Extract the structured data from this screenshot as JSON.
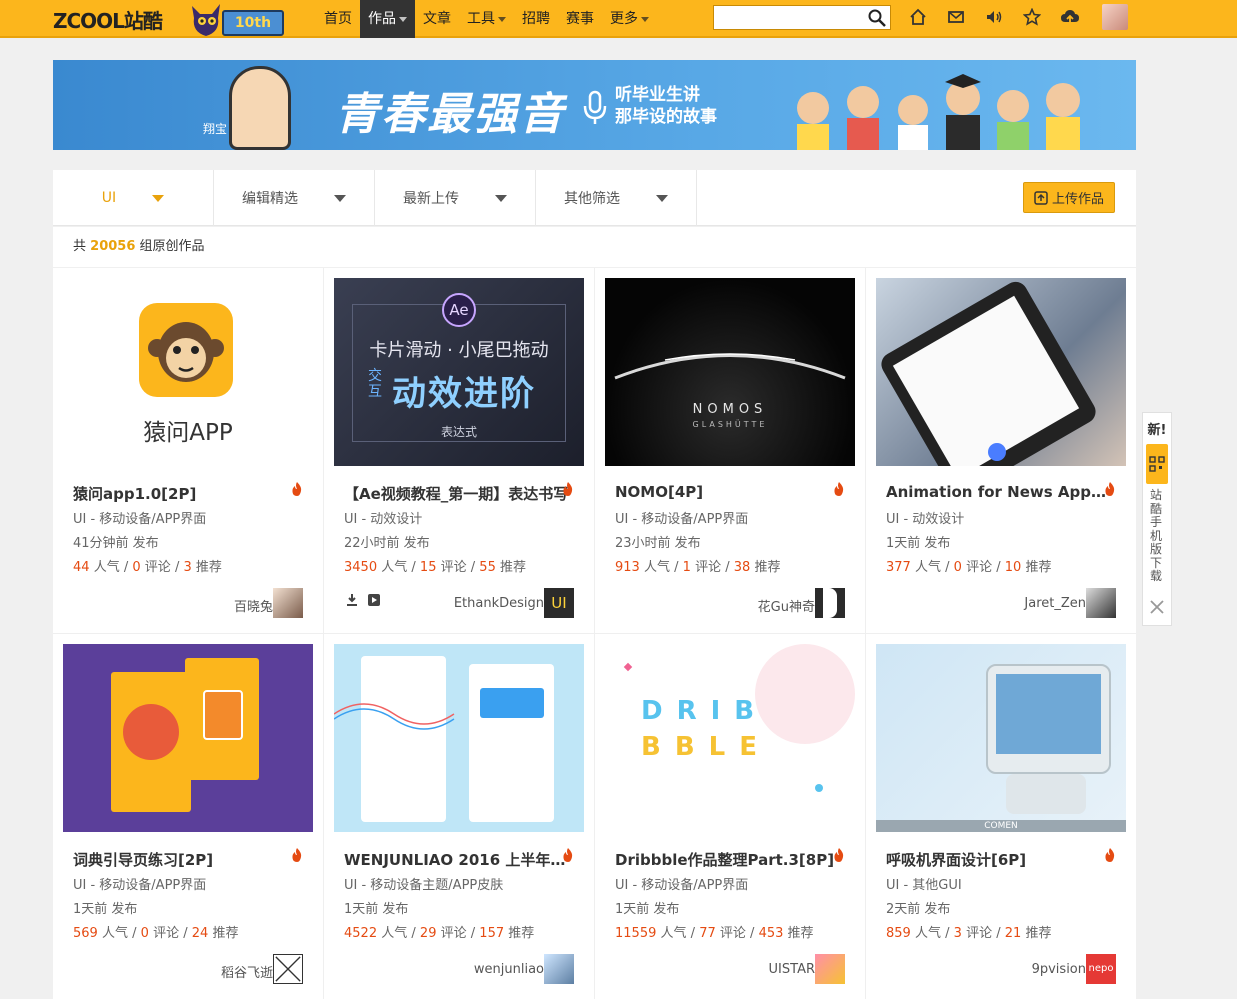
{
  "header": {
    "logo_text": "ZCOOL站酷",
    "badge_10th": "10th",
    "nav": [
      {
        "label": "首页",
        "caret": false
      },
      {
        "label": "作品",
        "caret": true,
        "active": true
      },
      {
        "label": "文章",
        "caret": false
      },
      {
        "label": "工具",
        "caret": true
      },
      {
        "label": "招聘",
        "caret": false
      },
      {
        "label": "赛事",
        "caret": false
      },
      {
        "label": "更多",
        "caret": true
      }
    ],
    "search_placeholder": "",
    "icons": [
      "home-icon",
      "mail-icon",
      "sound-icon",
      "star-icon",
      "upload-cloud-icon"
    ]
  },
  "banner": {
    "title": "青春最强音",
    "sub_line1": "听毕业生讲",
    "sub_line2": "那毕设的故事",
    "mascot_label": "翔宝"
  },
  "filters": [
    {
      "label": "UI",
      "active": true
    },
    {
      "label": "编辑精选"
    },
    {
      "label": "最新上传"
    },
    {
      "label": "其他筛选"
    }
  ],
  "upload_label": "上传作品",
  "count": {
    "prefix": "共",
    "number": "20056",
    "suffix": "组原创作品"
  },
  "cards": [
    {
      "title": "猿问app1.0[2P]",
      "category": "UI - 移动设备/APP界面",
      "time": "41分钟前 发布",
      "views": "44",
      "comments": "0",
      "recs": "3",
      "author": "百晓兔",
      "thumb_text": "猿问APP",
      "tools": false
    },
    {
      "title": "【Ae视频教程_第一期】表达书写",
      "category": "UI - 动效设计",
      "time": "22小时前 发布",
      "views": "3450",
      "comments": "15",
      "recs": "55",
      "author": "EthankDesign",
      "thumb_text": "卡片滑动 · 小尾巴拖动",
      "thumb_text2": "动效进阶",
      "thumb_text3": "表达式",
      "thumb_text4": "交互",
      "tools": true,
      "avatar_text": "UI"
    },
    {
      "title": "NOMO[4P]",
      "category": "UI - 移动设备/APP界面",
      "time": "23小时前 发布",
      "views": "913",
      "comments": "1",
      "recs": "38",
      "author": "花Gu神奇",
      "thumb_text": "NOMOS",
      "thumb_text2": "GLASHÜTTE",
      "tools": false
    },
    {
      "title": "Animation for News App S...",
      "category": "UI - 动效设计",
      "time": "1天前 发布",
      "views": "377",
      "comments": "0",
      "recs": "10",
      "author": "Jaret_Zen",
      "tools": false
    },
    {
      "title": "词典引导页练习[2P]",
      "category": "UI - 移动设备/APP界面",
      "time": "1天前 发布",
      "views": "569",
      "comments": "0",
      "recs": "24",
      "author": "稻谷飞逝",
      "tools": false
    },
    {
      "title": "WENJUNLIAO 2016 上半年[...]",
      "category": "UI - 移动设备主题/APP皮肤",
      "time": "1天前 发布",
      "views": "4522",
      "comments": "29",
      "recs": "157",
      "author": "wenjunliao",
      "tools": false
    },
    {
      "title": "Dribbble作品整理Part.3[8P]",
      "category": "UI - 移动设备/APP界面",
      "time": "1天前 发布",
      "views": "11559",
      "comments": "77",
      "recs": "453",
      "author": "UISTAR",
      "thumb_text": "DRIB",
      "thumb_text2": "BBLE",
      "tools": false
    },
    {
      "title": "呼吸机界面设计[6P]",
      "category": "UI - 其他GUI",
      "time": "2天前 发布",
      "views": "859",
      "comments": "3",
      "recs": "21",
      "author": "9pvision",
      "thumb_text": "COMEN",
      "avatar_text": "nepo",
      "tools": false
    }
  ],
  "stat_labels": {
    "views": "人气",
    "comments": "评论",
    "recs": "推荐",
    "sep": "/"
  },
  "side": {
    "new_label": "新!",
    "text": "站酷手机版下载"
  },
  "colors": {
    "brand": "#fcb61c",
    "accent_number": "#e54b12",
    "active_filter": "#e9a20b"
  }
}
